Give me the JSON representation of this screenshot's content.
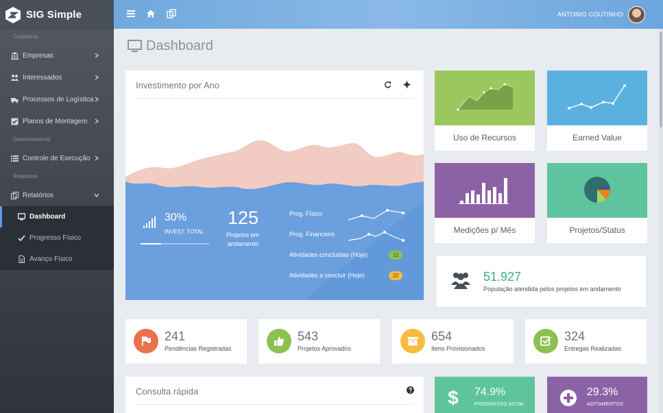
{
  "brand": {
    "name": "SIG Simple"
  },
  "sidebar": {
    "sections": [
      "Cadastros",
      "Gerenciamento",
      "Relatórios"
    ],
    "items": [
      {
        "label": "Empresas",
        "icon": "bank-icon"
      },
      {
        "label": "Interessados",
        "icon": "users-icon"
      },
      {
        "label": "Processos de Logística",
        "icon": "truck-icon"
      },
      {
        "label": "Planos de Montagem",
        "icon": "checkbox-icon"
      },
      {
        "label": "Controle de Execução",
        "icon": "list-icon"
      },
      {
        "label": "Relatórios",
        "icon": "copy-icon"
      }
    ],
    "sub_items": [
      {
        "label": "Dashboard",
        "icon": "monitor-icon",
        "active": true
      },
      {
        "label": "Progresso Físico",
        "icon": "check-icon"
      },
      {
        "label": "Avanço Físico",
        "icon": "document-icon"
      }
    ]
  },
  "topbar": {
    "user": "ANTONIO COUTINHO"
  },
  "page": {
    "title": "Dashboard"
  },
  "invest": {
    "title": "Investimento por Ano",
    "pct": "30%",
    "pct_label": "INVEST. TOTAL",
    "pct_progress": 0.3,
    "count": "125",
    "count_label_1": "Projetos em",
    "count_label_2": "andamento",
    "rows": [
      {
        "label": "Prog. Físico"
      },
      {
        "label": "Prog. Financeiro"
      },
      {
        "label": "Atividades concluídas (Hoje)",
        "badge": "11",
        "badge_color": "#8cc152"
      },
      {
        "label": "Atividades a concluir (Hoje)",
        "badge": "20",
        "badge_color": "#f6bb42"
      }
    ]
  },
  "tiles": [
    {
      "label": "Uso de Recursos",
      "color": "#9bc85e"
    },
    {
      "label": "Earned Value",
      "color": "#5ab1e0"
    },
    {
      "label": "Medições p/ Mês",
      "color": "#8c62a6"
    },
    {
      "label": "Projetos/Status",
      "color": "#5ec49e"
    }
  ],
  "population": {
    "value": "51.927",
    "label": "População atendida pelos projetos em andamento"
  },
  "stats": [
    {
      "value": "241",
      "label": "Pendências Registradas",
      "color": "#e9724c",
      "icon": "flag-icon"
    },
    {
      "value": "543",
      "label": "Projetos Aprovados",
      "color": "#8cc152",
      "icon": "thumbs-up-icon"
    },
    {
      "value": "654",
      "label": "Itens Provisionados",
      "color": "#f6bb42",
      "icon": "archive-icon"
    },
    {
      "value": "324",
      "label": "Entregas Realizadas",
      "color": "#8cc152",
      "icon": "check-square-icon"
    }
  ],
  "consulta": {
    "title": "Consulta rápida"
  },
  "kpis": [
    {
      "value": "74.9%",
      "label": "PROGRESSO ACUM.",
      "color": "#5ec49e",
      "icon": "dollar-icon"
    },
    {
      "value": "29.3%",
      "label": "ADITAMENTOS",
      "color": "#8c62a6",
      "icon": "plus-circle-icon"
    }
  ]
}
